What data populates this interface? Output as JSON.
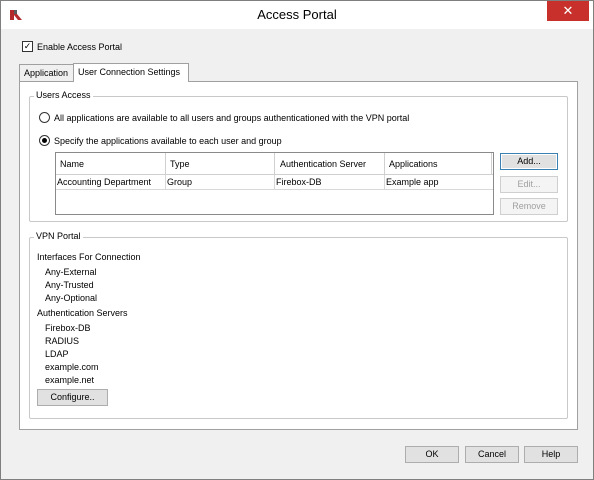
{
  "window": {
    "title": "Access Portal",
    "close_glyph": "✕"
  },
  "enable_portal": {
    "label": "Enable Access Portal",
    "checked": true
  },
  "tabs": [
    {
      "label": "Application"
    },
    {
      "label": "User Connection Settings"
    }
  ],
  "users_access": {
    "group_label": "Users Access",
    "option_all": "All applications are available to all users and groups authenticationed with the VPN portal",
    "option_specify": "Specify the applications available to each user and group",
    "selected": "specify",
    "columns": [
      "Name",
      "Type",
      "Authentication Server",
      "Applications"
    ],
    "rows": [
      [
        "Accounting Department",
        "Group",
        "Firebox-DB",
        "Example app"
      ]
    ],
    "buttons": {
      "add": "Add...",
      "edit": "Edit...",
      "remove": "Remove"
    }
  },
  "vpn_portal": {
    "group_label": "VPN Portal",
    "interfaces_heading": "Interfaces For Connection",
    "interfaces": [
      "Any-External",
      "Any-Trusted",
      "Any-Optional"
    ],
    "auth_heading": "Authentication Servers",
    "auth_servers": [
      "Firebox-DB",
      "RADIUS",
      "LDAP",
      "example.com",
      "example.net"
    ],
    "configure_button": "Configure.."
  },
  "footer": {
    "ok": "OK",
    "cancel": "Cancel",
    "help": "Help"
  }
}
